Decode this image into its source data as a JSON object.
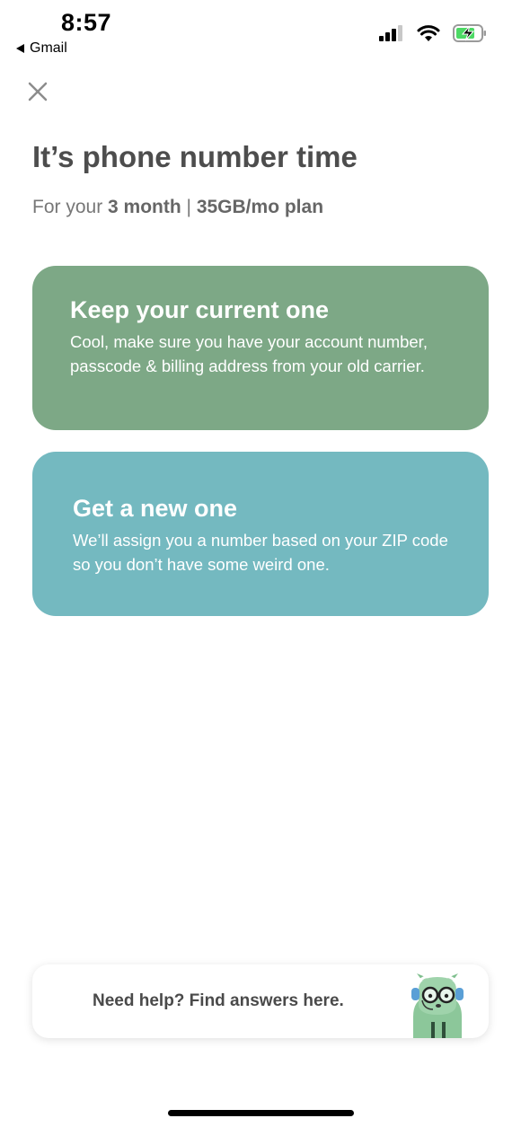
{
  "status_bar": {
    "time": "8:57",
    "back_app": "Gmail",
    "icons": [
      "cellular-signal-icon",
      "wifi-icon",
      "battery-charging-icon"
    ]
  },
  "header": {
    "close_icon": "close-icon",
    "title": "It’s phone number time",
    "subtitle_prefix": "For your ",
    "plan_length": "3 month",
    "plan_separator": " | ",
    "plan_data": "35GB/mo plan"
  },
  "options": [
    {
      "title": "Keep your current one",
      "description": "Cool, make sure you have your account number, passcode & billing address from your old carrier.",
      "color": "#7da886"
    },
    {
      "title": "Get a new one",
      "description": "We’ll assign you a number based on your ZIP code so you don’t have some weird one.",
      "color": "#74b9c0"
    }
  ],
  "help": {
    "label": "Need help? Find answers here.",
    "mascot_icon": "mascot-icon"
  }
}
